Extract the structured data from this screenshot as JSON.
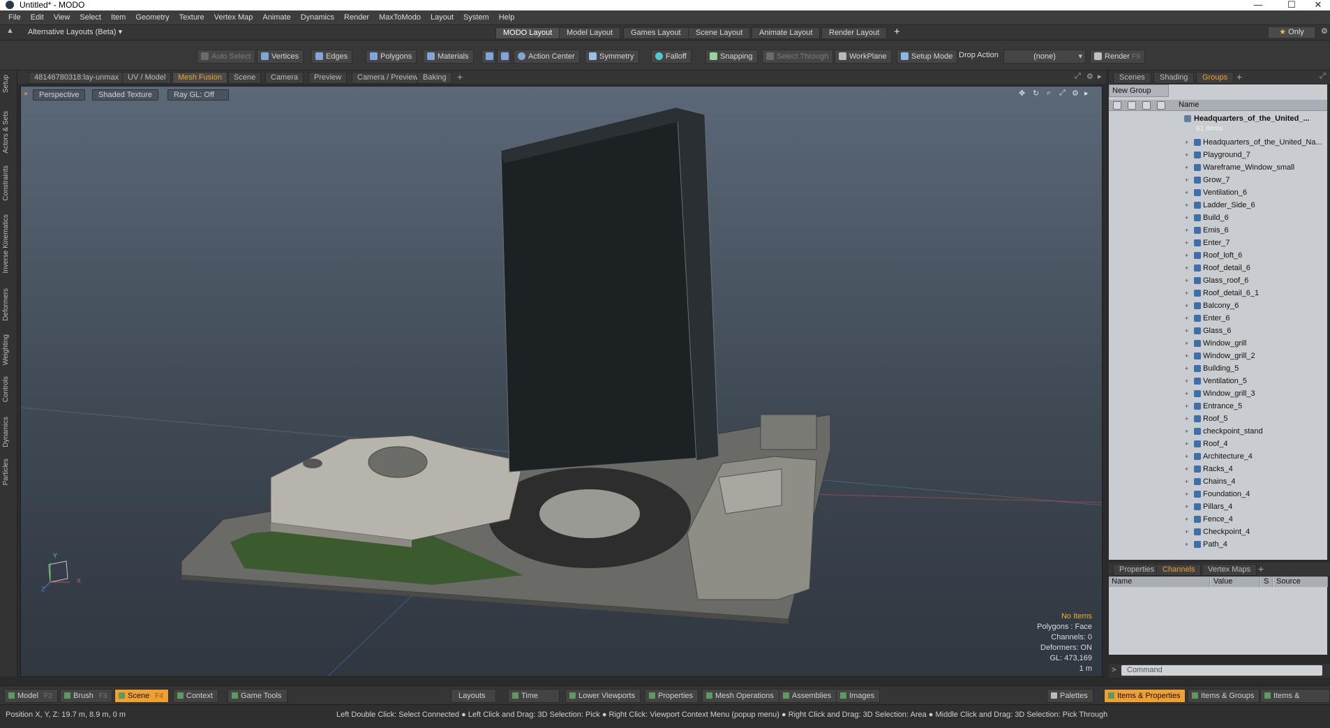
{
  "window": {
    "title": "Untitled* - MODO"
  },
  "menu": [
    "File",
    "Edit",
    "View",
    "Select",
    "Item",
    "Geometry",
    "Texture",
    "Vertex Map",
    "Animate",
    "Dynamics",
    "Render",
    "MaxToModo",
    "Layout",
    "System",
    "Help"
  ],
  "layout_selector": "Alternative Layouts (Beta)",
  "layout_tabs": [
    "MODO Layout",
    "Model Layout",
    "Games Layout",
    "Scene Layout",
    "Animate Layout",
    "Render Layout"
  ],
  "only_label": "Only",
  "toolbar": {
    "auto_select": "Auto Select",
    "vertices": "Vertices",
    "edges": "Edges",
    "polygons": "Polygons",
    "materials": "Materials",
    "action_center": "Action Center",
    "symmetry": "Symmetry",
    "falloff": "Falloff",
    "snapping": "Snapping",
    "select_through": "Select Through",
    "workplane": "WorkPlane",
    "setup_mode": "Setup Mode",
    "drop_action": "Drop Action",
    "drop_value": "(none)",
    "render": "Render",
    "render_key": "F9"
  },
  "left_tabs": [
    "Setup",
    "Actors & Sets",
    "Constraints",
    "Inverse Kinematics",
    "Deformers",
    "Weighting",
    "Controls",
    "Dynamics",
    "Particles"
  ],
  "viewport_tabs": [
    "48146780318:lay-unmax",
    "UV / Model",
    "Mesh Fusion",
    "Scene",
    "Camera",
    "Preview",
    "Camera / Preview",
    "Baking"
  ],
  "viewport": {
    "view_mode": "Perspective",
    "shading": "Shaded Texture",
    "raygl": "Ray GL: Off",
    "hud": {
      "items": "No Items",
      "polygons": "Polygons : Face",
      "channels": "Channels: 0",
      "deformers": "Deformers: ON",
      "gl": "GL: 473,169",
      "scale": "1 m"
    }
  },
  "right_tabs": [
    "Scenes",
    "Shading",
    "Groups"
  ],
  "groups": {
    "new_group": "New Group",
    "column_name": "Name",
    "root": {
      "name": "Headquarters_of_the_United_...",
      "count": "61 Items"
    },
    "items": [
      "Headquarters_of_the_United_Na...",
      "Playground_7",
      "Wareframe_Window_small",
      "Grow_7",
      "Ventilation_6",
      "Ladder_Side_6",
      "Build_6",
      "Emis_6",
      "Enter_7",
      "Roof_loft_6",
      "Roof_detail_6",
      "Glass_roof_6",
      "Roof_detail_6_1",
      "Balcony_6",
      "Enter_6",
      "Glass_6",
      "Window_grill",
      "Window_grill_2",
      "Building_5",
      "Ventilation_5",
      "Window_grill_3",
      "Entrance_5",
      "Roof_5",
      "checkpoint_stand",
      "Roof_4",
      "Architecture_4",
      "Racks_4",
      "Chains_4",
      "Foundation_4",
      "Pillars_4",
      "Fence_4",
      "Checkpoint_4",
      "Path_4"
    ]
  },
  "prop_tabs": [
    "Properties",
    "Channels",
    "Vertex Maps"
  ],
  "channels_columns": [
    "Name",
    "Value",
    "S",
    "Source"
  ],
  "command_placeholder": "Command",
  "bottom": {
    "model": "Model",
    "model_key": "F2",
    "brush": "Brush",
    "brush_key": "F3",
    "scene": "Scene",
    "scene_key": "F4",
    "context": "Context",
    "game_tools": "Game Tools",
    "layouts": "Layouts",
    "time": "Time",
    "lower_viewports": "Lower Viewports",
    "properties": "Properties",
    "mesh_operations": "Mesh Operations",
    "assemblies": "Assemblies",
    "images": "Images",
    "palettes": "Palettes",
    "items_properties": "Items & Properties",
    "items_groups": "Items & Groups",
    "items_shading": "Items & Shading"
  },
  "status": {
    "position": "Position X, Y, Z:   19.7 m, 8.9 m, 0 m",
    "hint": "Left Double Click: Select Connected ● Left Click and Drag: 3D Selection: Pick ● Right Click: Viewport Context Menu (popup menu) ● Right Click and Drag: 3D Selection: Area ● Middle Click and Drag: 3D Selection: Pick Through"
  }
}
